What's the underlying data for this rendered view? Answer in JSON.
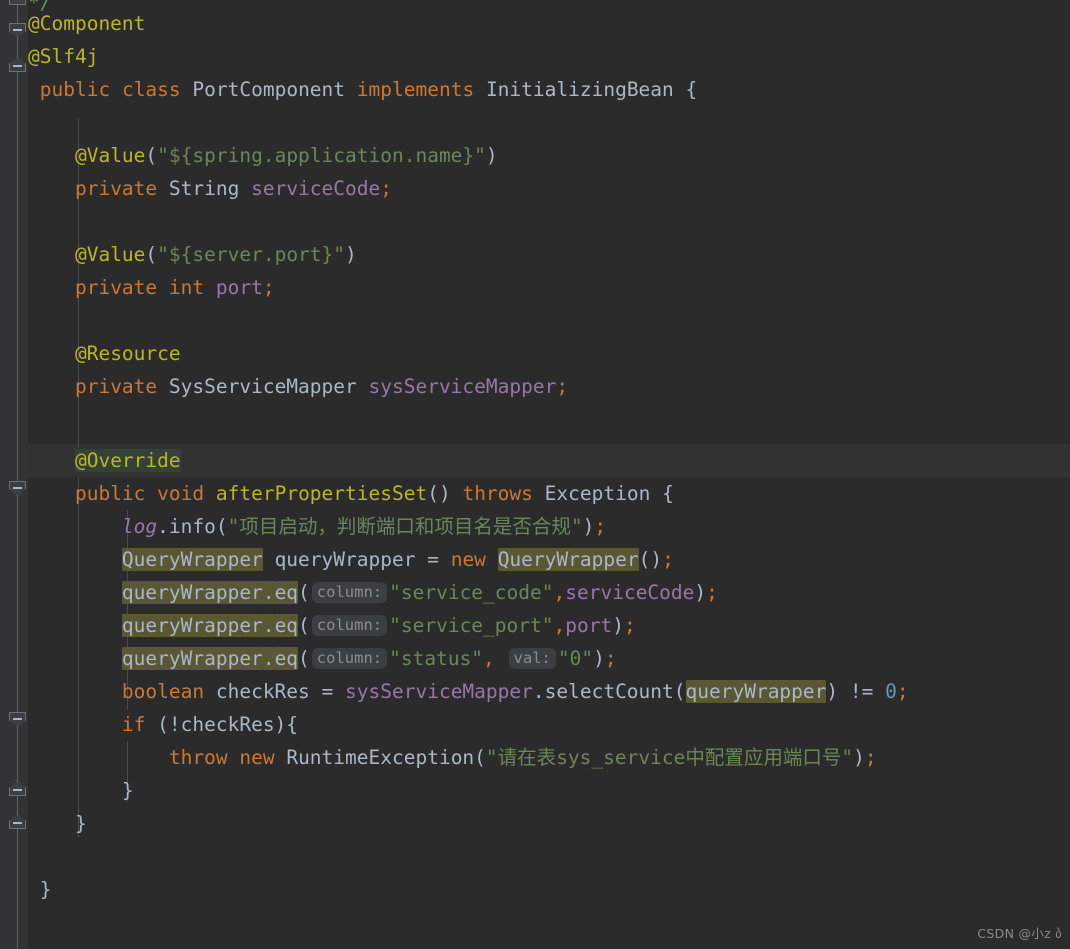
{
  "editor": {
    "theme_name": "darcula",
    "background": "#2b2b2b",
    "gutter_background": "#313335",
    "caret_line_background": "#323232",
    "occurrence_highlight_color": "#5a5734",
    "annotation_highlight_color": "#344134",
    "inlay_hint_background": "#3c3f41"
  },
  "code": {
    "line01_comment_tail": "*/",
    "line02_annotation": "@Component",
    "line03_annotation": "@Slf4j",
    "line04": {
      "kw_public": "public",
      "kw_class": "class",
      "class_name": "PortComponent",
      "kw_implements": "implements",
      "interface_name": "InitializingBean",
      "brace_open": "{"
    },
    "line06": {
      "annotation": "@Value",
      "paren_open": "(",
      "quote": "\"",
      "expr": "${spring.application.name}",
      "paren_close": ")"
    },
    "line07": {
      "kw_private": "private",
      "type": "String",
      "field": "serviceCode",
      "semicolon": ";"
    },
    "line09": {
      "annotation": "@Value",
      "paren_open": "(",
      "quote": "\"",
      "expr": "${server.port}",
      "paren_close": ")"
    },
    "line10": {
      "kw_private": "private",
      "kw_int": "int",
      "field": "port",
      "semicolon": ";"
    },
    "line12_annotation": "@Resource",
    "line13": {
      "kw_private": "private",
      "type": "SysServiceMapper",
      "field": "sysServiceMapper",
      "semicolon": ";"
    },
    "line15_annotation": "@Override",
    "line16": {
      "kw_public": "public",
      "kw_void": "void",
      "method": "afterPropertiesSet",
      "parens": "()",
      "kw_throws": "throws",
      "exception_type": "Exception",
      "brace_open": "{"
    },
    "line17": {
      "logger": "log",
      "dot": ".",
      "method": "info",
      "paren_open": "(",
      "quote": "\"",
      "message": "项目启动，判断端口和项目名是否合规",
      "paren_close": ")",
      "semicolon": ";"
    },
    "line18": {
      "type": "QueryWrapper",
      "var": "queryWrapper",
      "equals": "=",
      "kw_new": "new",
      "ctor": "QueryWrapper",
      "parens": "()",
      "semicolon": ";"
    },
    "line19": {
      "var": "queryWrapper",
      "dot": ".",
      "method": "eq",
      "paren_open": "(",
      "hint_label": "column:",
      "arg_string": "\"service_code\"",
      "comma": ",",
      "arg_field": "serviceCode",
      "paren_close": ")",
      "semicolon": ";"
    },
    "line20": {
      "var": "queryWrapper",
      "dot": ".",
      "method": "eq",
      "paren_open": "(",
      "hint_label": "column:",
      "arg_string": "\"service_port\"",
      "comma": ",",
      "arg_field": "port",
      "paren_close": ")",
      "semicolon": ";"
    },
    "line21": {
      "var": "queryWrapper",
      "dot": ".",
      "method": "eq",
      "paren_open": "(",
      "hint_label": "column:",
      "arg_string": "\"status\"",
      "comma": ",",
      "hint_label2": "val:",
      "arg_string2": "\"0\"",
      "paren_close": ")",
      "semicolon": ";"
    },
    "line22": {
      "kw_boolean": "boolean",
      "var": "checkRes",
      "equals": "=",
      "field": "sysServiceMapper",
      "dot": ".",
      "method": "selectCount",
      "paren_open": "(",
      "arg": "queryWrapper",
      "paren_close": ")",
      "operator": "!=",
      "number": "0",
      "semicolon": ";"
    },
    "line23": {
      "kw_if": "if",
      "condition": "(!checkRes)",
      "brace_open": "{"
    },
    "line24": {
      "kw_throw": "throw",
      "kw_new": "new",
      "exception_type": "RuntimeException",
      "paren_open": "(",
      "quote": "\"",
      "message_cjk1": "请在表",
      "message_ascii": "sys_service",
      "message_cjk2": "中配置应用端口号",
      "paren_close": ")",
      "semicolon": ";"
    },
    "line25_brace": "}",
    "line26_brace": "}",
    "line28_brace": "}"
  },
  "watermark": {
    "text": "CSDN @小z ბ"
  }
}
